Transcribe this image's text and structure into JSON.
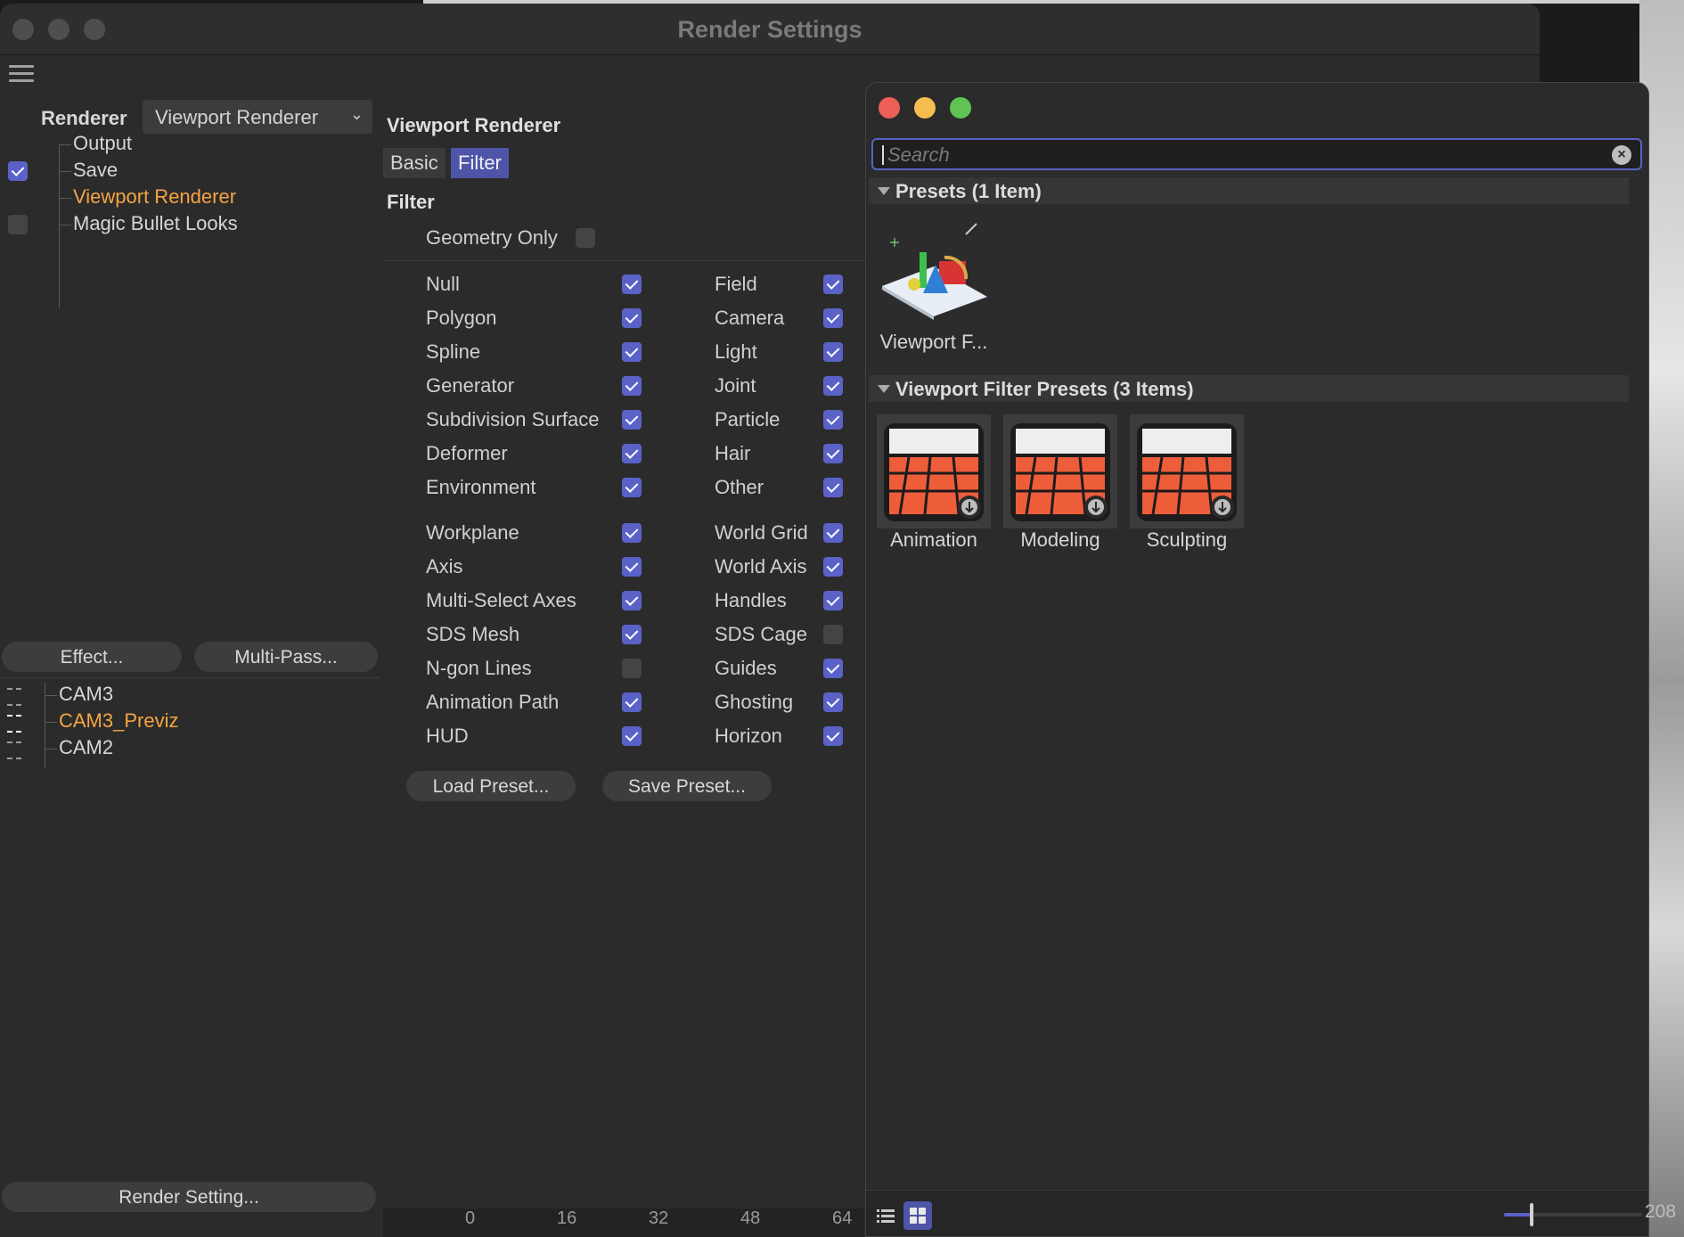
{
  "window": {
    "title": "Render Settings"
  },
  "left": {
    "renderer_label": "Renderer",
    "renderer_value": "Viewport Renderer",
    "tree": [
      {
        "label": "Output",
        "checkbox": "none",
        "active": false
      },
      {
        "label": "Save",
        "checkbox": "on",
        "active": false
      },
      {
        "label": "Viewport Renderer",
        "checkbox": "none",
        "active": true
      },
      {
        "label": "Magic Bullet Looks",
        "checkbox": "off",
        "active": false
      }
    ],
    "effect_button": "Effect...",
    "multipass_button": "Multi-Pass...",
    "cameras": [
      {
        "label": "CAM3",
        "active": false
      },
      {
        "label": "CAM3_Previz",
        "active": true
      },
      {
        "label": "CAM2",
        "active": false
      }
    ],
    "render_setting_button": "Render Setting..."
  },
  "middle": {
    "title": "Viewport Renderer",
    "tabs": [
      "Basic",
      "Filter"
    ],
    "active_tab": "Filter",
    "section": "Filter",
    "geometry_only": {
      "label": "Geometry Only",
      "checked": false
    },
    "filters_group1": [
      [
        {
          "label": "Null",
          "checked": true
        },
        {
          "label": "Field",
          "checked": true
        }
      ],
      [
        {
          "label": "Polygon",
          "checked": true
        },
        {
          "label": "Camera",
          "checked": true
        }
      ],
      [
        {
          "label": "Spline",
          "checked": true
        },
        {
          "label": "Light",
          "checked": true
        }
      ],
      [
        {
          "label": "Generator",
          "checked": true
        },
        {
          "label": "Joint",
          "checked": true
        }
      ],
      [
        {
          "label": "Subdivision Surface",
          "checked": true
        },
        {
          "label": "Particle",
          "checked": true
        }
      ],
      [
        {
          "label": "Deformer",
          "checked": true
        },
        {
          "label": "Hair",
          "checked": true
        }
      ],
      [
        {
          "label": "Environment",
          "checked": true
        },
        {
          "label": "Other",
          "checked": true
        }
      ]
    ],
    "filters_group2": [
      [
        {
          "label": "Workplane",
          "checked": true
        },
        {
          "label": "World Grid",
          "checked": true
        }
      ],
      [
        {
          "label": "Axis",
          "checked": true
        },
        {
          "label": "World Axis",
          "checked": true
        }
      ],
      [
        {
          "label": "Multi-Select Axes",
          "checked": true
        },
        {
          "label": "Handles",
          "checked": true
        }
      ],
      [
        {
          "label": "SDS Mesh",
          "checked": true
        },
        {
          "label": "SDS Cage",
          "checked": false
        }
      ],
      [
        {
          "label": "N-gon Lines",
          "checked": false
        },
        {
          "label": "Guides",
          "checked": true
        }
      ],
      [
        {
          "label": "Animation Path",
          "checked": true
        },
        {
          "label": "Ghosting",
          "checked": true
        }
      ],
      [
        {
          "label": "HUD",
          "checked": true
        },
        {
          "label": "Horizon",
          "checked": true
        }
      ]
    ],
    "load_preset": "Load Preset...",
    "save_preset": "Save Preset..."
  },
  "preset_window": {
    "search_placeholder": "Search",
    "search_value": "",
    "group1": {
      "title": "Presets (1 Item)",
      "items": [
        "Viewport F..."
      ]
    },
    "group2": {
      "title": "Viewport Filter Presets (3 Items)",
      "items": [
        "Animation",
        "Modeling",
        "Sculpting"
      ]
    },
    "zoom_level": 0.2
  },
  "timeline": {
    "ticks": [
      "0",
      "16",
      "32",
      "48",
      "64"
    ],
    "frame_readout": "208"
  },
  "colors": {
    "accent": "#5a62c8",
    "active_text": "#f5a442",
    "close": "#ed5f57",
    "minimize": "#f5bd4f",
    "zoom": "#5fc454",
    "preset_icon": "#ee5d3a"
  }
}
